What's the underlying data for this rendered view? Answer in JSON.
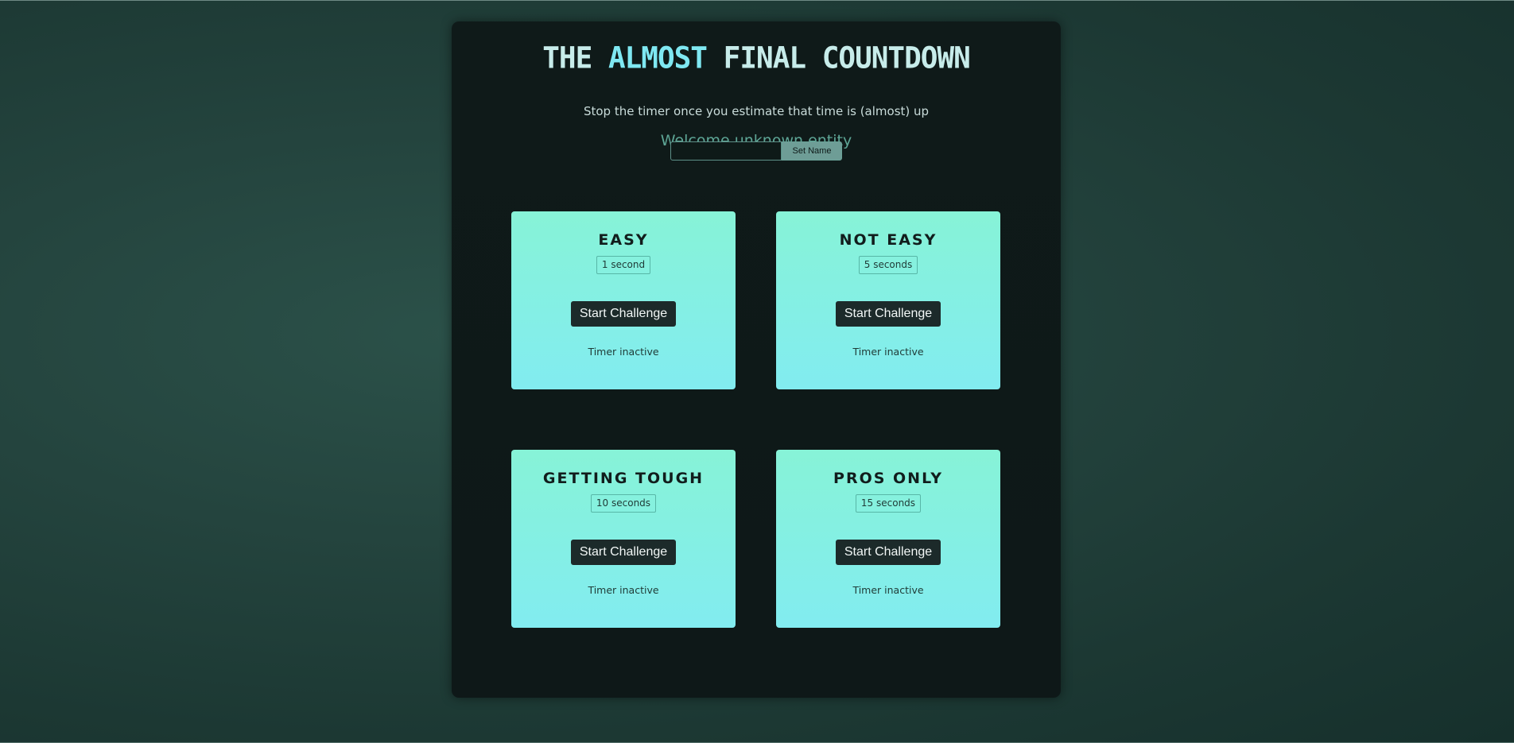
{
  "header": {
    "title_prefix": "THE",
    "title_accent": "ALMOST",
    "title_suffix": "FINAL COUNTDOWN",
    "subtitle": "Stop the timer once you estimate that time is (almost) up",
    "welcome": "Welcome unknown entity"
  },
  "name_form": {
    "input_value": "",
    "input_placeholder": "",
    "button_label": "Set Name"
  },
  "challenges": [
    {
      "title": "EASY",
      "duration": "1 second",
      "button_label": "Start Challenge",
      "status": "Timer inactive"
    },
    {
      "title": "NOT EASY",
      "duration": "5 seconds",
      "button_label": "Start Challenge",
      "status": "Timer inactive"
    },
    {
      "title": "GETTING TOUGH",
      "duration": "10 seconds",
      "button_label": "Start Challenge",
      "status": "Timer inactive"
    },
    {
      "title": "PROS ONLY",
      "duration": "15 seconds",
      "button_label": "Start Challenge",
      "status": "Timer inactive"
    }
  ],
  "colors": {
    "accent": "#7fe8f2",
    "card_gradient_top": "#87f3d7",
    "card_gradient_bottom": "#82ecf0",
    "button_dark": "#1c2a2a",
    "welcome_text": "#5ea696"
  }
}
